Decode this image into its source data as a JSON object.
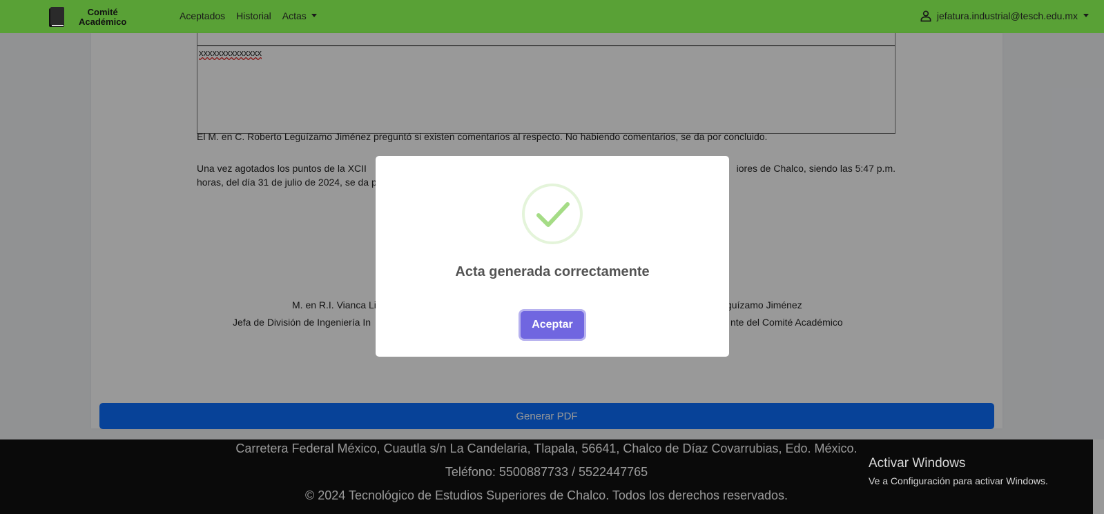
{
  "navbar": {
    "brand": {
      "line1": "Comité",
      "line2": "Académico"
    },
    "links": [
      {
        "label": "Aceptados"
      },
      {
        "label": "Historial"
      },
      {
        "label": "Actas"
      }
    ],
    "user_email": "jefatura.industrial@tesch.edu.mx"
  },
  "document": {
    "textarea_value": "xxxxxxxxxxxxxx",
    "paragraph_1": "El M. en C. Roberto Leguízamo Jiménez preguntó si existen comentarios al respecto. No habiendo comentarios, se da por concluido.",
    "paragraph_2_line1_left": "Una vez agotados los puntos de la XCII",
    "paragraph_2_line1_right": "iores de Chalco, siendo las 5:47 p.m.",
    "paragraph_2_line2_left": "horas, del día 31 de julio de 2024, se da p",
    "signatures": [
      {
        "name_visible": "M. en R.I. Vianca Li",
        "role_visible": "Jefa de División de Ingeniería In"
      },
      {
        "name_visible": "guízamo Jiménez",
        "role_visible": "nte del Comité Académico"
      }
    ],
    "generate_pdf_label": "Generar PDF"
  },
  "footer": {
    "address": "Carretera Federal México, Cuautla s/n La Candelaria, Tlapala, 56641, Chalco de Díaz Covarrubias, Edo. México.",
    "phone": "Teléfono: 5500887733 / 5522447765",
    "copyright": "© 2024 Tecnológico de Estudios Superiores de Chalco. Todos los derechos reservados."
  },
  "modal": {
    "icon": "success-check-icon",
    "title": "Acta generada correctamente",
    "confirm_label": "Aceptar",
    "icon_color": "#a5dc86",
    "confirm_color": "#7066e0"
  },
  "watermark": {
    "title": "Activar Windows",
    "subtitle": "Ve a Configuración para activar Windows."
  },
  "colors": {
    "navbar": "#59a136",
    "primary_button": "#0d6efd",
    "footer": "#111111"
  }
}
